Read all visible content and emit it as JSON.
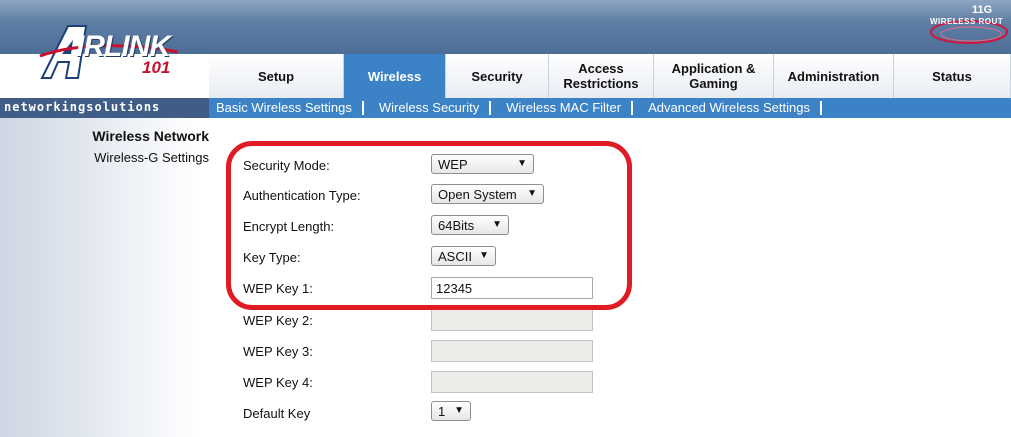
{
  "brand": {
    "logo_word": "IRLINK",
    "logo_number": "101",
    "tagline": "networkingsolutions",
    "badge_number": "11G",
    "badge_title": "WIRELESS ROUT"
  },
  "tabs": [
    {
      "label": "Setup"
    },
    {
      "label": "Wireless",
      "active": true
    },
    {
      "label": "Security"
    },
    {
      "label": "Access Restrictions"
    },
    {
      "label": "Application & Gaming"
    },
    {
      "label": "Administration"
    },
    {
      "label": "Status"
    }
  ],
  "subnav": [
    {
      "label": "Basic Wireless Settings"
    },
    {
      "label": "Wireless Security"
    },
    {
      "label": "Wireless MAC Filter"
    },
    {
      "label": "Advanced Wireless Settings"
    }
  ],
  "sidebar": {
    "title": "Wireless Network",
    "item": "Wireless-G Settings"
  },
  "form": {
    "security_mode": {
      "label": "Security Mode:",
      "value": "WEP"
    },
    "auth_type": {
      "label": "Authentication Type:",
      "value": "Open System"
    },
    "encrypt_length": {
      "label": "Encrypt Length:",
      "value": "64Bits"
    },
    "key_type": {
      "label": "Key Type:",
      "value": "ASCII"
    },
    "wep_key_1": {
      "label": "WEP Key 1:",
      "value": "12345"
    },
    "wep_key_2": {
      "label": "WEP Key 2:",
      "value": ""
    },
    "wep_key_3": {
      "label": "WEP Key 3:",
      "value": ""
    },
    "wep_key_4": {
      "label": "WEP Key 4:",
      "value": ""
    },
    "default_key": {
      "label": "Default Key",
      "value": "1"
    }
  },
  "colors": {
    "accent": "#3c82c6",
    "header": "#5f7ea4",
    "highlight": "#e01b24"
  }
}
